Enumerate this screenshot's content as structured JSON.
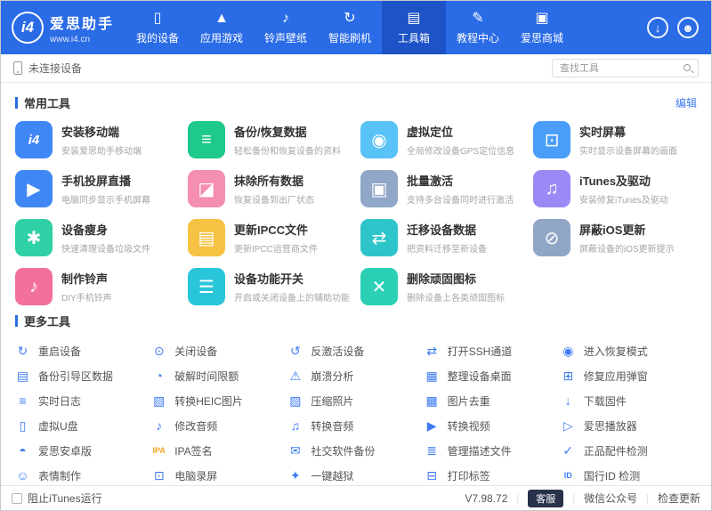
{
  "colors": {
    "header_bg": "#2a6be6",
    "header_active_bg": "#1d53c6",
    "accent": "#2a6be6",
    "link": "#3f7bf0"
  },
  "header": {
    "logo": {
      "badge": "i4",
      "brand": "爱思助手",
      "site": "www.i4.cn"
    },
    "nav": [
      {
        "name": "my-devices",
        "label": "我的设备",
        "glyph": "▯",
        "active": false
      },
      {
        "name": "apps-games",
        "label": "应用游戏",
        "glyph": "▲",
        "active": false
      },
      {
        "name": "ringtones-wallpapers",
        "label": "铃声壁纸",
        "glyph": "♪",
        "active": false
      },
      {
        "name": "smart-flash",
        "label": "智能刷机",
        "glyph": "↻",
        "active": false
      },
      {
        "name": "toolbox",
        "label": "工具箱",
        "glyph": "▤",
        "active": true
      },
      {
        "name": "tutorial-center",
        "label": "教程中心",
        "glyph": "✎",
        "active": false
      },
      {
        "name": "i4-store",
        "label": "爱思商城",
        "glyph": "▣",
        "active": false
      }
    ],
    "download_icon": "↓",
    "user_icon": "☻"
  },
  "device_bar": {
    "status": "未连接设备",
    "search_placeholder": "查找工具"
  },
  "common_tools": {
    "title": "常用工具",
    "edit_label": "编辑",
    "items": [
      {
        "name": "install-mobile",
        "title": "安装移动端",
        "subtitle": "安装爱思助手移动端",
        "glyph": "i4",
        "icon_bg": "#3f87f5"
      },
      {
        "name": "backup-restore",
        "title": "备份/恢复数据",
        "subtitle": "轻松备份和恢复设备的资料",
        "glyph": "≡",
        "icon_bg": "#1ec98b"
      },
      {
        "name": "virtual-location",
        "title": "虚拟定位",
        "subtitle": "全局修改设备GPS定位信息",
        "glyph": "◉",
        "icon_bg": "#59c2f7"
      },
      {
        "name": "realtime-screen",
        "title": "实时屏幕",
        "subtitle": "实时显示设备屏幕的画面",
        "glyph": "⊡",
        "icon_bg": "#4a9df8"
      },
      {
        "name": "screen-mirroring",
        "title": "手机投屏直播",
        "subtitle": "电脑同步显示手机屏幕",
        "glyph": "▶",
        "icon_bg": "#3f87f5"
      },
      {
        "name": "erase-all-data",
        "title": "抹除所有数据",
        "subtitle": "恢复设备到出厂状态",
        "glyph": "◪",
        "icon_bg": "#f48fb1"
      },
      {
        "name": "batch-activation",
        "title": "批量激活",
        "subtitle": "支持多台设备同时进行激活",
        "glyph": "▣",
        "icon_bg": "#90a7c7"
      },
      {
        "name": "itunes-driver",
        "title": "iTunes及驱动",
        "subtitle": "安装修复iTunes及驱动",
        "glyph": "♫",
        "icon_bg": "#9b8af5"
      },
      {
        "name": "device-slimming",
        "title": "设备瘦身",
        "subtitle": "快速清理设备垃圾文件",
        "glyph": "✱",
        "icon_bg": "#2fd0a6"
      },
      {
        "name": "update-ipcc",
        "title": "更新IPCC文件",
        "subtitle": "更新IPCC运营商文件",
        "glyph": "▤",
        "icon_bg": "#f6c244"
      },
      {
        "name": "migrate-device-data",
        "title": "迁移设备数据",
        "subtitle": "把资料迁移至新设备",
        "glyph": "⇄",
        "icon_bg": "#2ec5ca"
      },
      {
        "name": "block-ios-update",
        "title": "屏蔽iOS更新",
        "subtitle": "屏蔽设备的iOS更新提示",
        "glyph": "⊘",
        "icon_bg": "#8fa6c6"
      },
      {
        "name": "make-ringtone",
        "title": "制作铃声",
        "subtitle": "DIY手机铃声",
        "glyph": "♪",
        "icon_bg": "#f2709b"
      },
      {
        "name": "device-switches",
        "title": "设备功能开关",
        "subtitle": "开启或关闭设备上的辅助功能",
        "glyph": "☰",
        "icon_bg": "#29c5d8"
      },
      {
        "name": "delete-stubborn-icons",
        "title": "删除顽固图标",
        "subtitle": "删除设备上各类顽固图标",
        "glyph": "✕",
        "icon_bg": "#2bd0b4"
      }
    ]
  },
  "more_tools": {
    "title": "更多工具",
    "items": [
      {
        "name": "restart-device",
        "label": "重启设备",
        "glyph": "↻",
        "color": "#3f7bf0"
      },
      {
        "name": "shutdown-device",
        "label": "关闭设备",
        "glyph": "⊙",
        "color": "#3f7bf0"
      },
      {
        "name": "deactivate-device",
        "label": "反激活设备",
        "glyph": "↺",
        "color": "#3f7bf0"
      },
      {
        "name": "open-ssh-tunnel",
        "label": "打开SSH通道",
        "glyph": "⇄",
        "color": "#3f7bf0"
      },
      {
        "name": "enter-recovery-mode",
        "label": "进入恢复模式",
        "glyph": "◉",
        "color": "#3f7bf0"
      },
      {
        "name": "backup-boot-data",
        "label": "备份引导区数据",
        "glyph": "▤",
        "color": "#3f7bf0"
      },
      {
        "name": "crack-screen-time",
        "label": "破解时间限额",
        "glyph": "◔",
        "color": "#3f7bf0"
      },
      {
        "name": "crash-analysis",
        "label": "崩溃分析",
        "glyph": "⚠",
        "color": "#3f7bf0"
      },
      {
        "name": "organize-home-screen",
        "label": "整理设备桌面",
        "glyph": "▦",
        "color": "#3f7bf0"
      },
      {
        "name": "fix-app-popup",
        "label": "修复应用弹窗",
        "glyph": "⊞",
        "color": "#3f7bf0"
      },
      {
        "name": "realtime-log",
        "label": "实时日志",
        "glyph": "≡",
        "color": "#3f7bf0"
      },
      {
        "name": "convert-heic",
        "label": "转换HEIC图片",
        "glyph": "▧",
        "color": "#3f7bf0"
      },
      {
        "name": "compress-photos",
        "label": "压缩照片",
        "glyph": "▨",
        "color": "#3f7bf0"
      },
      {
        "name": "dedupe-images",
        "label": "图片去重",
        "glyph": "▩",
        "color": "#3f7bf0"
      },
      {
        "name": "download-firmware",
        "label": "下载固件",
        "glyph": "↓",
        "color": "#3f7bf0"
      },
      {
        "name": "virtual-usb-drive",
        "label": "虚拟U盘",
        "glyph": "▯",
        "color": "#3f7bf0"
      },
      {
        "name": "edit-audio",
        "label": "修改音频",
        "glyph": "♪",
        "color": "#3f7bf0"
      },
      {
        "name": "convert-audio",
        "label": "转换音频",
        "glyph": "♫",
        "color": "#3f7bf0"
      },
      {
        "name": "convert-video",
        "label": "转换视频",
        "glyph": "▶",
        "color": "#3f7bf0"
      },
      {
        "name": "i4-player",
        "label": "爱思播放器",
        "glyph": "▷",
        "color": "#3f7bf0"
      },
      {
        "name": "i4-android",
        "label": "爱思安卓版",
        "glyph": "◓",
        "color": "#3f7bf0"
      },
      {
        "name": "ipa-signing",
        "label": "IPA签名",
        "glyph": "IPA",
        "color": "#f5a623"
      },
      {
        "name": "social-app-backup",
        "label": "社交软件备份",
        "glyph": "✉",
        "color": "#3f7bf0"
      },
      {
        "name": "manage-profiles",
        "label": "管理描述文件",
        "glyph": "≣",
        "color": "#3f7bf0"
      },
      {
        "name": "genuine-accessory-check",
        "label": "正品配件检测",
        "glyph": "✓",
        "color": "#3f7bf0"
      },
      {
        "name": "emoji-maker",
        "label": "表情制作",
        "glyph": "☺",
        "color": "#3f7bf0"
      },
      {
        "name": "pc-screen-record",
        "label": "电脑录屏",
        "glyph": "⊡",
        "color": "#3f7bf0"
      },
      {
        "name": "one-click-jailbreak",
        "label": "一键越狱",
        "glyph": "✦",
        "color": "#3f7bf0"
      },
      {
        "name": "print-label",
        "label": "打印标签",
        "glyph": "⊟",
        "color": "#3f7bf0"
      },
      {
        "name": "id-check",
        "label": "国行ID 检测",
        "glyph": "ID",
        "color": "#3f7bf0"
      }
    ]
  },
  "footer": {
    "block_itunes_label": "阻止iTunes运行",
    "version": "V7.98.72",
    "support_label": "客服",
    "wechat_label": "微信公众号",
    "update_label": "检查更新"
  }
}
